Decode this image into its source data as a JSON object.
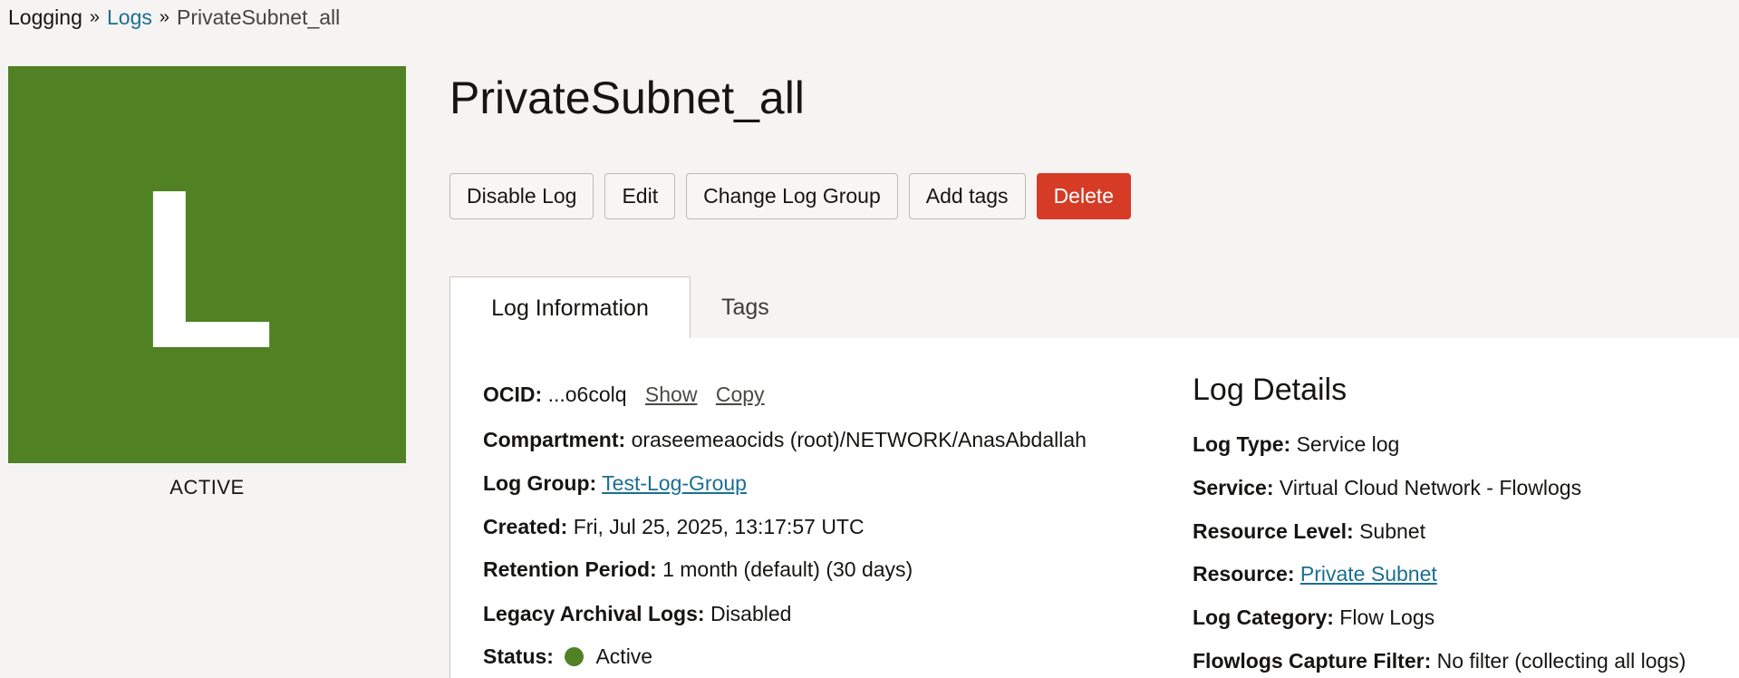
{
  "breadcrumb": {
    "root": "Logging",
    "parent": "Logs",
    "current": "PrivateSubnet_all",
    "separator": "»"
  },
  "tile": {
    "letter": "L",
    "status": "ACTIVE",
    "color": "#508123"
  },
  "title": "PrivateSubnet_all",
  "actions": {
    "disable": "Disable Log",
    "edit": "Edit",
    "change_group": "Change Log Group",
    "add_tags": "Add tags",
    "delete": "Delete"
  },
  "tabs": {
    "active": "Log Information",
    "inactive": "Tags"
  },
  "info": {
    "ocid_label": "OCID:",
    "ocid_value": "...o6colq",
    "ocid_show": "Show",
    "ocid_copy": "Copy",
    "compartment_label": "Compartment:",
    "compartment_value": "oraseemeaocids (root)/NETWORK/AnasAbdallah",
    "log_group_label": "Log Group:",
    "log_group_value": "Test-Log-Group",
    "created_label": "Created:",
    "created_value": "Fri, Jul 25, 2025, 13:17:57 UTC",
    "retention_label": "Retention Period:",
    "retention_value": "1 month (default) (30 days)",
    "legacy_label": "Legacy Archival Logs:",
    "legacy_value": "Disabled",
    "status_label": "Status:",
    "status_value": "Active"
  },
  "details": {
    "title": "Log Details",
    "log_type_label": "Log Type:",
    "log_type_value": "Service log",
    "service_label": "Service:",
    "service_value": "Virtual Cloud Network - Flowlogs",
    "resource_level_label": "Resource Level:",
    "resource_level_value": "Subnet",
    "resource_label": "Resource:",
    "resource_value": "Private Subnet",
    "category_label": "Log Category:",
    "category_value": "Flow Logs",
    "filter_label": "Flowlogs Capture Filter:",
    "filter_value": "No filter (collecting all logs)"
  },
  "colors": {
    "accent_link": "#1b6f91",
    "danger": "#d63b25",
    "status_active": "#508123"
  }
}
